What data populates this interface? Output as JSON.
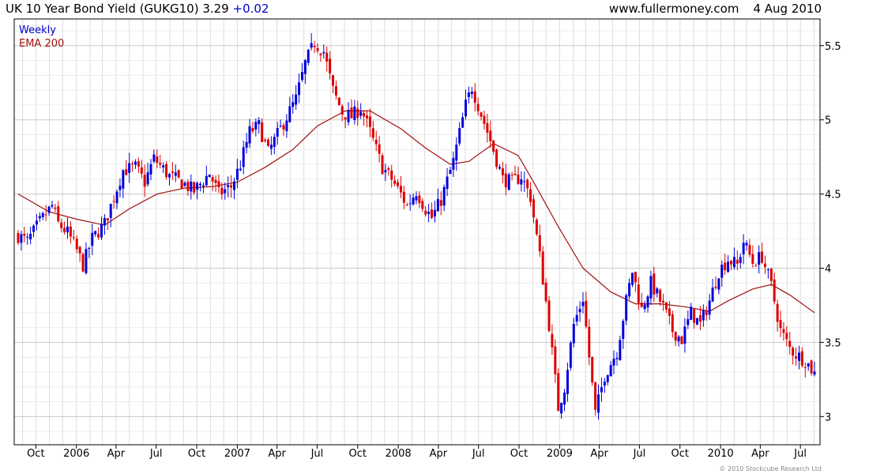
{
  "header": {
    "symbol_text": "UK 10 Year Bond Yield (GUKG10) 3.29",
    "change": "+0.02",
    "site": "www.fullermoney.com",
    "date": "4 Aug 2010"
  },
  "copyright": "© 2010 Stockcube Research Ltd",
  "colors": {
    "up": "#0000dd",
    "down": "#dd0000",
    "ema": "#a01010",
    "grid": "#dcdcdc",
    "frame": "#000000",
    "weekly_label": "#0000cc"
  },
  "chart_data": {
    "type": "candlestick",
    "frequency": "Weekly",
    "legend": [
      "Weekly",
      "EMA 200"
    ],
    "legend_position": "top-left",
    "x_range": [
      "2005-08-22",
      "2010-08-02"
    ],
    "ylim": [
      2.81,
      5.68
    ],
    "y_ticks": [
      3,
      3.5,
      4,
      4.5,
      5,
      5.5
    ],
    "y_axis_side": "right",
    "grid": true,
    "x_ticks": [
      {
        "date": "2005-10-01",
        "label": "Oct"
      },
      {
        "date": "2006-01-01",
        "label": "2006"
      },
      {
        "date": "2006-04-01",
        "label": "Apr"
      },
      {
        "date": "2006-07-01",
        "label": "Jul"
      },
      {
        "date": "2006-10-01",
        "label": "Oct"
      },
      {
        "date": "2007-01-01",
        "label": "2007"
      },
      {
        "date": "2007-04-01",
        "label": "Apr"
      },
      {
        "date": "2007-07-01",
        "label": "Jul"
      },
      {
        "date": "2007-10-01",
        "label": "Oct"
      },
      {
        "date": "2008-01-01",
        "label": "2008"
      },
      {
        "date": "2008-04-01",
        "label": "Apr"
      },
      {
        "date": "2008-07-01",
        "label": "Jul"
      },
      {
        "date": "2008-10-01",
        "label": "Oct"
      },
      {
        "date": "2009-01-01",
        "label": "2009"
      },
      {
        "date": "2009-04-01",
        "label": "Apr"
      },
      {
        "date": "2009-07-01",
        "label": "Jul"
      },
      {
        "date": "2009-10-01",
        "label": "Oct"
      },
      {
        "date": "2010-01-01",
        "label": "2010"
      },
      {
        "date": "2010-04-01",
        "label": "Apr"
      },
      {
        "date": "2010-07-01",
        "label": "Jul"
      }
    ],
    "close_path": [
      [
        "2005-08-22",
        4.22
      ],
      [
        "2005-09-12",
        4.18
      ],
      [
        "2005-10-10",
        4.31
      ],
      [
        "2005-11-07",
        4.42
      ],
      [
        "2005-11-21",
        4.3
      ],
      [
        "2005-12-12",
        4.24
      ],
      [
        "2006-01-02",
        4.12
      ],
      [
        "2006-01-16",
        4.02
      ],
      [
        "2006-02-06",
        4.2
      ],
      [
        "2006-03-06",
        4.3
      ],
      [
        "2006-03-27",
        4.48
      ],
      [
        "2006-04-17",
        4.66
      ],
      [
        "2006-05-15",
        4.68
      ],
      [
        "2006-06-05",
        4.58
      ],
      [
        "2006-06-26",
        4.74
      ],
      [
        "2006-07-31",
        4.62
      ],
      [
        "2006-08-28",
        4.58
      ],
      [
        "2006-09-25",
        4.52
      ],
      [
        "2006-10-30",
        4.64
      ],
      [
        "2006-11-20",
        4.5
      ],
      [
        "2006-12-18",
        4.55
      ],
      [
        "2007-01-08",
        4.7
      ],
      [
        "2007-01-29",
        4.92
      ],
      [
        "2007-02-19",
        4.96
      ],
      [
        "2007-03-12",
        4.78
      ],
      [
        "2007-04-02",
        4.9
      ],
      [
        "2007-04-23",
        5.02
      ],
      [
        "2007-05-14",
        5.14
      ],
      [
        "2007-06-04",
        5.38
      ],
      [
        "2007-06-25",
        5.52
      ],
      [
        "2007-07-16",
        5.46
      ],
      [
        "2007-08-06",
        5.2
      ],
      [
        "2007-08-27",
        5.05
      ],
      [
        "2007-09-17",
        5.02
      ],
      [
        "2007-10-08",
        5.08
      ],
      [
        "2007-10-29",
        4.92
      ],
      [
        "2007-11-26",
        4.68
      ],
      [
        "2007-12-17",
        4.6
      ],
      [
        "2008-01-07",
        4.5
      ],
      [
        "2008-01-21",
        4.42
      ],
      [
        "2008-02-11",
        4.52
      ],
      [
        "2008-03-03",
        4.4
      ],
      [
        "2008-03-17",
        4.34
      ],
      [
        "2008-04-07",
        4.46
      ],
      [
        "2008-05-05",
        4.72
      ],
      [
        "2008-06-02",
        5.1
      ],
      [
        "2008-06-16",
        5.22
      ],
      [
        "2008-07-07",
        5.04
      ],
      [
        "2008-07-28",
        4.86
      ],
      [
        "2008-08-25",
        4.6
      ],
      [
        "2008-09-15",
        4.58
      ],
      [
        "2008-10-06",
        4.62
      ],
      [
        "2008-10-27",
        4.48
      ],
      [
        "2008-11-17",
        4.08
      ],
      [
        "2008-12-08",
        3.62
      ],
      [
        "2008-12-29",
        3.06
      ],
      [
        "2009-01-12",
        3.2
      ],
      [
        "2009-02-02",
        3.62
      ],
      [
        "2009-02-23",
        3.8
      ],
      [
        "2009-03-09",
        3.4
      ],
      [
        "2009-03-23",
        3.02
      ],
      [
        "2009-04-13",
        3.28
      ],
      [
        "2009-05-11",
        3.44
      ],
      [
        "2009-06-01",
        3.78
      ],
      [
        "2009-06-15",
        3.98
      ],
      [
        "2009-07-06",
        3.72
      ],
      [
        "2009-07-27",
        3.9
      ],
      [
        "2009-08-24",
        3.74
      ],
      [
        "2009-09-14",
        3.58
      ],
      [
        "2009-10-05",
        3.52
      ],
      [
        "2009-10-26",
        3.7
      ],
      [
        "2009-11-16",
        3.62
      ],
      [
        "2009-12-07",
        3.78
      ],
      [
        "2009-12-28",
        3.98
      ],
      [
        "2010-01-18",
        4.06
      ],
      [
        "2010-02-08",
        4.02
      ],
      [
        "2010-02-22",
        4.18
      ],
      [
        "2010-03-15",
        4.04
      ],
      [
        "2010-04-05",
        4.08
      ],
      [
        "2010-04-26",
        3.88
      ],
      [
        "2010-05-17",
        3.58
      ],
      [
        "2010-06-07",
        3.46
      ],
      [
        "2010-06-21",
        3.42
      ],
      [
        "2010-07-12",
        3.38
      ],
      [
        "2010-08-02",
        3.29
      ]
    ],
    "ema_200": [
      [
        "2005-08-22",
        4.5
      ],
      [
        "2005-10-31",
        4.38
      ],
      [
        "2006-01-02",
        4.33
      ],
      [
        "2006-03-06",
        4.29
      ],
      [
        "2006-05-01",
        4.4
      ],
      [
        "2006-07-03",
        4.5
      ],
      [
        "2006-09-04",
        4.54
      ],
      [
        "2006-11-06",
        4.55
      ],
      [
        "2007-01-01",
        4.58
      ],
      [
        "2007-03-05",
        4.68
      ],
      [
        "2007-05-07",
        4.8
      ],
      [
        "2007-07-02",
        4.96
      ],
      [
        "2007-09-03",
        5.06
      ],
      [
        "2007-10-29",
        5.06
      ],
      [
        "2008-01-07",
        4.94
      ],
      [
        "2008-03-03",
        4.81
      ],
      [
        "2008-04-28",
        4.7
      ],
      [
        "2008-06-09",
        4.72
      ],
      [
        "2008-08-04",
        4.84
      ],
      [
        "2008-09-29",
        4.76
      ],
      [
        "2008-11-03",
        4.58
      ],
      [
        "2008-12-29",
        4.28
      ],
      [
        "2009-02-23",
        4.0
      ],
      [
        "2009-04-27",
        3.84
      ],
      [
        "2009-06-22",
        3.76
      ],
      [
        "2009-08-17",
        3.76
      ],
      [
        "2009-10-12",
        3.74
      ],
      [
        "2009-12-07",
        3.71
      ],
      [
        "2010-01-18",
        3.78
      ],
      [
        "2010-03-15",
        3.86
      ],
      [
        "2010-04-26",
        3.89
      ],
      [
        "2010-06-07",
        3.82
      ],
      [
        "2010-08-02",
        3.7
      ]
    ]
  }
}
